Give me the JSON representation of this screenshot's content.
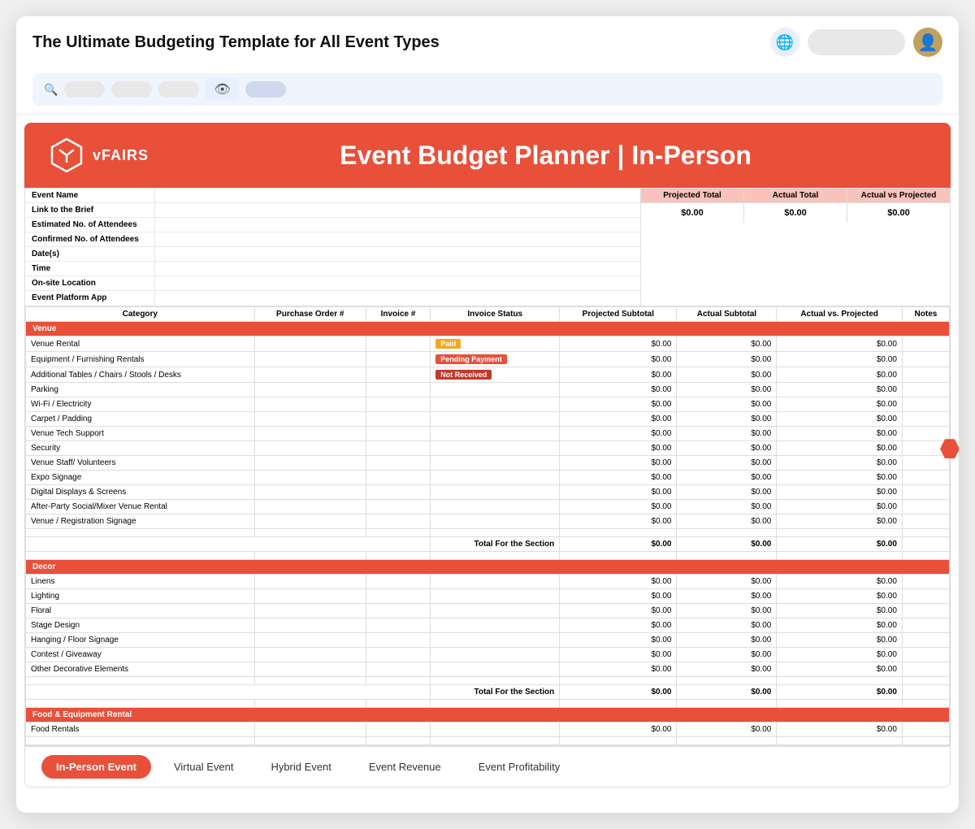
{
  "header": {
    "title": "The Ultimate Budgeting Template for All Event Types",
    "brand": "vFAIRS",
    "banner_title": "Event Budget Planner | In-Person"
  },
  "toolbar": {
    "search_placeholder": "Search..."
  },
  "info_rows": [
    {
      "label": "Event Name",
      "value": ""
    },
    {
      "label": "Link to the Brief",
      "value": ""
    },
    {
      "label": "Estimated No. of Attendees",
      "value": ""
    },
    {
      "label": "Confirmed No. of Attendees",
      "value": ""
    },
    {
      "label": "Date(s)",
      "value": ""
    },
    {
      "label": "Time",
      "value": ""
    },
    {
      "label": "On-site Location",
      "value": ""
    },
    {
      "label": "Event Platform App",
      "value": ""
    }
  ],
  "summary_headers": [
    "Projected Total",
    "Actual Total",
    "Actual vs Projected"
  ],
  "summary_values": [
    "$0.00",
    "$0.00",
    "$0.00"
  ],
  "table_headers": [
    "Category",
    "Purchase Order #",
    "Invoice #",
    "Invoice Status",
    "Projected Subtotal",
    "Actual Subtotal",
    "Actual vs. Projected",
    "Notes"
  ],
  "sections": [
    {
      "name": "Venue",
      "rows": [
        {
          "category": "Venue Rental",
          "po": "",
          "inv": "",
          "status": "Paid",
          "projected": "$0.00",
          "actual": "$0.00",
          "vs": "$0.00",
          "notes": ""
        },
        {
          "category": "Equipment / Furnishing Rentals",
          "po": "",
          "inv": "",
          "status": "Pending Payment",
          "projected": "$0.00",
          "actual": "$0.00",
          "vs": "$0.00",
          "notes": ""
        },
        {
          "category": "Additional Tables / Chairs / Stools / Desks",
          "po": "",
          "inv": "",
          "status": "Not Received",
          "projected": "$0.00",
          "actual": "$0.00",
          "vs": "$0.00",
          "notes": ""
        },
        {
          "category": "Parking",
          "po": "",
          "inv": "",
          "status": "",
          "projected": "$0.00",
          "actual": "$0.00",
          "vs": "$0.00",
          "notes": ""
        },
        {
          "category": "Wi-Fi / Electricity",
          "po": "",
          "inv": "",
          "status": "",
          "projected": "$0.00",
          "actual": "$0.00",
          "vs": "$0.00",
          "notes": ""
        },
        {
          "category": "Carpet / Padding",
          "po": "",
          "inv": "",
          "status": "",
          "projected": "$0.00",
          "actual": "$0.00",
          "vs": "$0.00",
          "notes": ""
        },
        {
          "category": "Venue Tech Support",
          "po": "",
          "inv": "",
          "status": "",
          "projected": "$0.00",
          "actual": "$0.00",
          "vs": "$0.00",
          "notes": ""
        },
        {
          "category": "Security",
          "po": "",
          "inv": "",
          "status": "",
          "projected": "$0.00",
          "actual": "$0.00",
          "vs": "$0.00",
          "notes": ""
        },
        {
          "category": "Venue Staff/ Volunteers",
          "po": "",
          "inv": "",
          "status": "",
          "projected": "$0.00",
          "actual": "$0.00",
          "vs": "$0.00",
          "notes": ""
        },
        {
          "category": "Expo Signage",
          "po": "",
          "inv": "",
          "status": "",
          "projected": "$0.00",
          "actual": "$0.00",
          "vs": "$0.00",
          "notes": ""
        },
        {
          "category": "Digital Displays & Screens",
          "po": "",
          "inv": "",
          "status": "",
          "projected": "$0.00",
          "actual": "$0.00",
          "vs": "$0.00",
          "notes": ""
        },
        {
          "category": "After-Party Social/Mixer Venue Rental",
          "po": "",
          "inv": "",
          "status": "",
          "projected": "$0.00",
          "actual": "$0.00",
          "vs": "$0.00",
          "notes": ""
        },
        {
          "category": "Venue / Registration Signage",
          "po": "",
          "inv": "",
          "status": "",
          "projected": "$0.00",
          "actual": "$0.00",
          "vs": "$0.00",
          "notes": ""
        }
      ],
      "total": {
        "label": "Total For the Section",
        "projected": "$0.00",
        "actual": "$0.00",
        "vs": "$0.00"
      }
    },
    {
      "name": "Decor",
      "rows": [
        {
          "category": "Linens",
          "po": "",
          "inv": "",
          "status": "",
          "projected": "$0.00",
          "actual": "$0.00",
          "vs": "$0.00",
          "notes": ""
        },
        {
          "category": "Lighting",
          "po": "",
          "inv": "",
          "status": "",
          "projected": "$0.00",
          "actual": "$0.00",
          "vs": "$0.00",
          "notes": ""
        },
        {
          "category": "Floral",
          "po": "",
          "inv": "",
          "status": "",
          "projected": "$0.00",
          "actual": "$0.00",
          "vs": "$0.00",
          "notes": ""
        },
        {
          "category": "Stage Design",
          "po": "",
          "inv": "",
          "status": "",
          "projected": "$0.00",
          "actual": "$0.00",
          "vs": "$0.00",
          "notes": ""
        },
        {
          "category": "Hanging / Floor Signage",
          "po": "",
          "inv": "",
          "status": "",
          "projected": "$0.00",
          "actual": "$0.00",
          "vs": "$0.00",
          "notes": ""
        },
        {
          "category": "Contest / Giveaway",
          "po": "",
          "inv": "",
          "status": "",
          "projected": "$0.00",
          "actual": "$0.00",
          "vs": "$0.00",
          "notes": ""
        },
        {
          "category": "Other Decorative Elements",
          "po": "",
          "inv": "",
          "status": "",
          "projected": "$0.00",
          "actual": "$0.00",
          "vs": "$0.00",
          "notes": ""
        }
      ],
      "total": {
        "label": "Total For the Section",
        "projected": "$0.00",
        "actual": "$0.00",
        "vs": "$0.00"
      }
    },
    {
      "name": "Food & Equipment Rental",
      "rows": [
        {
          "category": "Food Rentals",
          "po": "",
          "inv": "",
          "status": "",
          "projected": "$0.00",
          "actual": "$0.00",
          "vs": "$0.00",
          "notes": ""
        }
      ],
      "total": null
    }
  ],
  "tabs": [
    {
      "label": "In-Person Event",
      "active": true
    },
    {
      "label": "Virtual Event",
      "active": false
    },
    {
      "label": "Hybrid Event",
      "active": false
    },
    {
      "label": "Event Revenue",
      "active": false
    },
    {
      "label": "Event Profitability",
      "active": false
    }
  ]
}
